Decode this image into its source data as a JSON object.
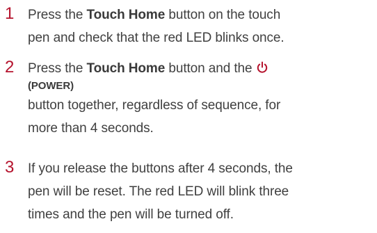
{
  "steps": [
    {
      "number": "1",
      "line1_pre": "Press the ",
      "line1_bold": "Touch Home",
      "line1_post": " button on the touch",
      "line2": "pen and check that the red LED blinks once."
    },
    {
      "number": "2",
      "line1_pre": "Press the ",
      "line1_bold": "Touch Home",
      "line1_post": " button and the",
      "power_label": "(POWER)",
      "line3": "button together, regardless of sequence, for",
      "line4": "more than 4 seconds."
    },
    {
      "number": "3",
      "line1": "If you release the buttons after 4 seconds, the",
      "line2": "pen will be reset. The red LED will blink three",
      "line3": "times and the pen will be turned off."
    }
  ],
  "icons": {
    "power": "power-icon"
  },
  "colors": {
    "step_number": "#b5132d",
    "text": "#404040"
  }
}
